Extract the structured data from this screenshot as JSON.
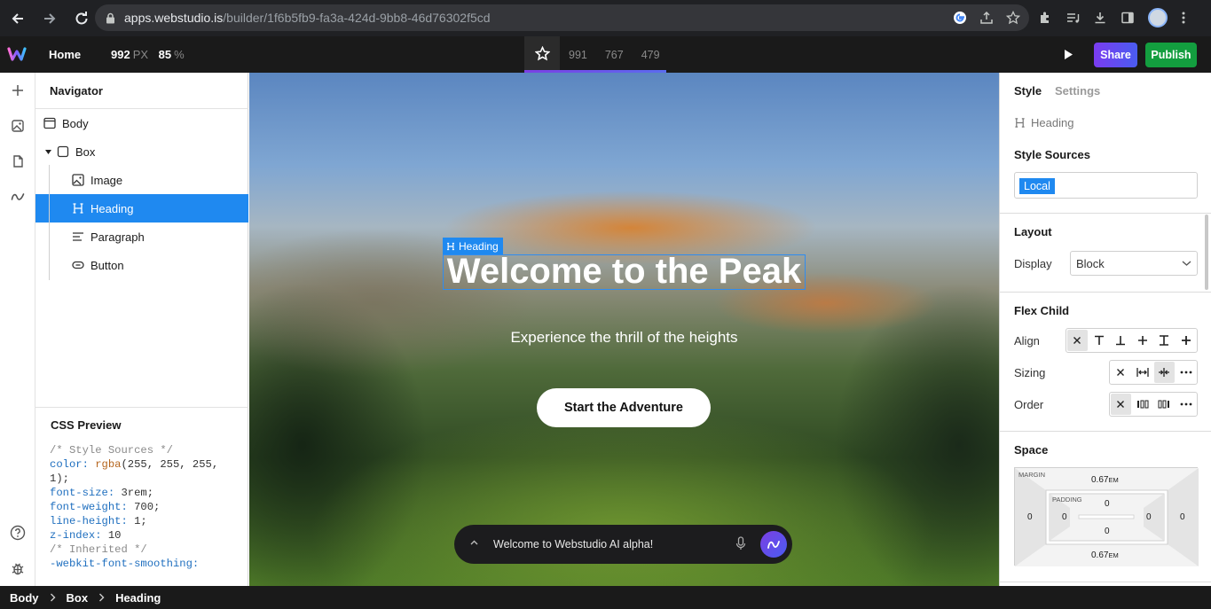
{
  "browser": {
    "url_host": "apps.webstudio.is",
    "url_path": "/builder/1f6b5fb9-fa3a-424d-9bb8-46d76302f5cd"
  },
  "topbar": {
    "page": "Home",
    "width": "992",
    "width_unit": "PX",
    "zoom": "85",
    "zoom_unit": "%",
    "breakpoints": [
      "991",
      "767",
      "479"
    ],
    "share_label": "Share",
    "publish_label": "Publish"
  },
  "navigator": {
    "title": "Navigator",
    "items": [
      {
        "label": "Body",
        "icon": "body-icon"
      },
      {
        "label": "Box",
        "icon": "box-icon"
      },
      {
        "label": "Image",
        "icon": "image-icon"
      },
      {
        "label": "Heading",
        "icon": "heading-icon"
      },
      {
        "label": "Paragraph",
        "icon": "paragraph-icon"
      },
      {
        "label": "Button",
        "icon": "button-icon"
      }
    ],
    "selected": "Heading"
  },
  "css_preview": {
    "title": "CSS Preview",
    "comment1": "/* Style Sources */",
    "color_prop": "color:",
    "color_fn": "rgba",
    "color_args1": "(255, 255, 255,",
    "color_args2": "1);",
    "font_size_prop": "font-size:",
    "font_size_val": "3rem;",
    "font_weight_prop": "font-weight:",
    "font_weight_val": "700;",
    "line_height_prop": "line-height:",
    "line_height_val": "1;",
    "z_index_prop": "z-index:",
    "z_index_val": "10",
    "comment2": "/* Inherited */",
    "smoothing_prop": "-webkit-font-smoothing:"
  },
  "canvas": {
    "selection_label": "Heading",
    "heading": "Welcome to the Peak",
    "paragraph": "Experience the thrill of the heights",
    "cta": "Start the Adventure",
    "ai_prompt": "Welcome to Webstudio AI alpha!"
  },
  "style_panel": {
    "tab_style": "Style",
    "tab_settings": "Settings",
    "component": "Heading",
    "style_sources_label": "Style Sources",
    "style_source_chip": "Local",
    "layout_title": "Layout",
    "display_label": "Display",
    "display_value": "Block",
    "flex_child_title": "Flex Child",
    "align_label": "Align",
    "sizing_label": "Sizing",
    "order_label": "Order",
    "space_title": "Space",
    "margin_label": "MARGIN",
    "padding_label": "PADDING",
    "margin_top": "0.67",
    "margin_top_unit": "EM",
    "margin_bottom": "0.67",
    "margin_bottom_unit": "EM",
    "margin_left": "0",
    "margin_right": "0",
    "padding_top": "0",
    "padding_bottom": "0",
    "padding_left": "0",
    "padding_right": "0"
  },
  "breadcrumbs": [
    "Body",
    "Box",
    "Heading"
  ],
  "colors": {
    "accent": "#1f89f0",
    "publish": "#139e3f",
    "share_start": "#7a3cf0",
    "share_end": "#4a5cf0"
  }
}
